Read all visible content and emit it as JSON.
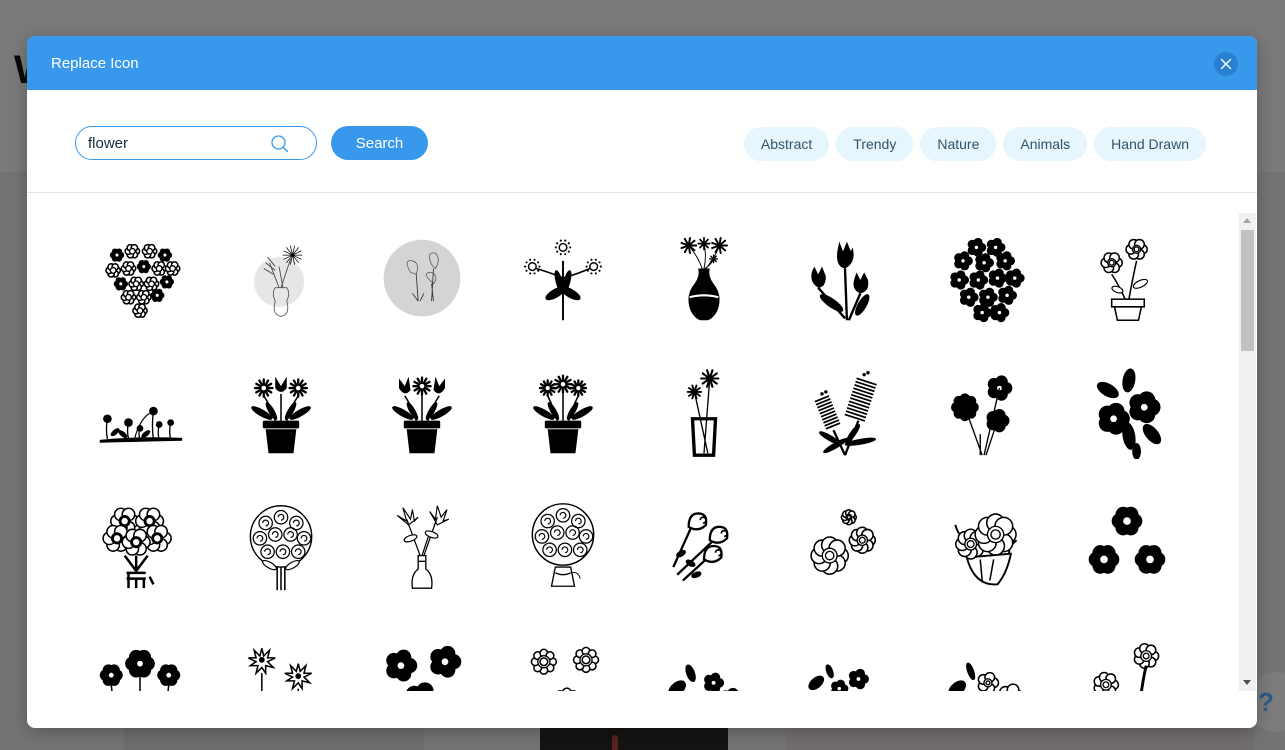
{
  "background": {
    "logo_text": "W",
    "help_label": "?"
  },
  "modal": {
    "title": "Replace Icon",
    "close_icon": "close-icon",
    "search": {
      "value": "flower",
      "placeholder": "",
      "icon": "search-icon",
      "button_label": "Search"
    },
    "tags": [
      {
        "label": "Abstract"
      },
      {
        "label": "Trendy"
      },
      {
        "label": "Nature"
      },
      {
        "label": "Animals"
      },
      {
        "label": "Hand Drawn"
      }
    ],
    "icons": [
      {
        "name": "flower-heart-icon"
      },
      {
        "name": "sketch-vase-bouquet-icon"
      },
      {
        "name": "sketch-tulips-circle-icon"
      },
      {
        "name": "dotted-flower-stem-icon"
      },
      {
        "name": "vase-flowers-icon"
      },
      {
        "name": "tulip-bunch-icon"
      },
      {
        "name": "flower-cluster-icon"
      },
      {
        "name": "potted-flower-outline-icon"
      },
      {
        "name": "flower-meadow-icon"
      },
      {
        "name": "potted-flowers-icon"
      },
      {
        "name": "potted-tulips-icon"
      },
      {
        "name": "potted-daisies-icon"
      },
      {
        "name": "glass-vase-flowers-icon"
      },
      {
        "name": "bottlebrush-flower-icon"
      },
      {
        "name": "flower-bunch-icon"
      },
      {
        "name": "flowers-leaves-icon"
      },
      {
        "name": "bouquet-outline-icon"
      },
      {
        "name": "rose-bouquet-icon"
      },
      {
        "name": "slim-vase-flowers-icon"
      },
      {
        "name": "wrapped-rose-bouquet-icon"
      },
      {
        "name": "rosebud-bunch-icon"
      },
      {
        "name": "outline-blossoms-icon"
      },
      {
        "name": "flower-posy-icon"
      },
      {
        "name": "three-flowers-icon"
      },
      {
        "name": "filled-flowers-icon"
      },
      {
        "name": "starburst-flowers-icon"
      },
      {
        "name": "blossom-pair-icon"
      },
      {
        "name": "daisy-pair-icon"
      },
      {
        "name": "leafy-blossoms-icon"
      },
      {
        "name": "small-blossoms-icon"
      },
      {
        "name": "outline-leafy-blossoms-icon"
      },
      {
        "name": "daisy-stems-icon"
      }
    ],
    "scrollbar": {
      "position_fraction": 0.0,
      "visible_fraction": 0.25
    }
  },
  "colors": {
    "accent": "#3899ec",
    "close_bg": "#2b7fd0",
    "tag_bg": "#e7f5fd",
    "tag_text": "#32536a"
  }
}
